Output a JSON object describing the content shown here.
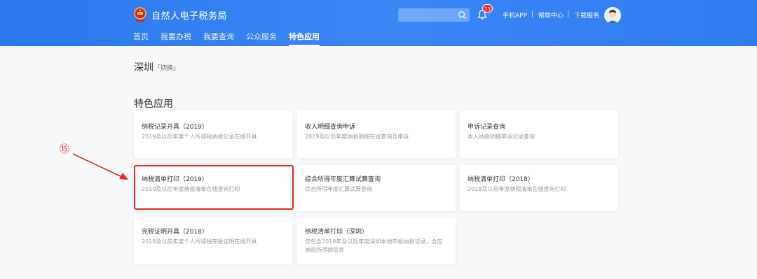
{
  "header": {
    "site_title": "自然人电子税务局",
    "nav": [
      "首页",
      "我要办税",
      "我要查询",
      "公众服务",
      "特色应用"
    ],
    "active_nav": "特色应用",
    "search_placeholder": "",
    "notification_count": "13",
    "links": [
      "手机APP",
      "帮助中心",
      "下载服务"
    ]
  },
  "location": {
    "city": "深圳",
    "switch_label": "「切换」"
  },
  "section": {
    "title": "特色应用"
  },
  "cards": [
    {
      "title": "纳税记录开具（2019）",
      "desc": [
        "2019及以后年度个人所得税纳税记录在线开具"
      ]
    },
    {
      "title": "收入明细查询申诉",
      "desc": [
        "2019及以后年度纳税明细在线查询及申诉"
      ]
    },
    {
      "title": "申诉记录查询",
      "desc": [
        "收入纳税明细申诉记录查询"
      ]
    },
    {
      "title": "纳税清单打印（2019）",
      "desc": [
        "2019及以后年度纳税清单在线查询打印"
      ]
    },
    {
      "title": "综合所得年度汇算试算查询",
      "desc": [
        "综合所得年度汇算试算查询"
      ]
    },
    {
      "title": "纳税清单打印（2018）",
      "desc": [
        "2018及以前年度纳税清单在线查询打印"
      ]
    },
    {
      "title": "完税证明开具（2018）",
      "desc": [
        "2018及以前年度个人所得税完税证明在线开具"
      ]
    },
    {
      "title": "纳税清单打印（深圳）",
      "desc": [
        "仅包含2019年及以后年度深圳本地申报纳税记录，含应",
        "纳税所得额信息"
      ]
    }
  ],
  "annotation": {
    "step_marker": "⑮",
    "highlight_color": "#e8271f"
  },
  "colors": {
    "header_blue": "#2f7cf0",
    "badge_red": "#f5222d"
  },
  "icons": [
    "national-emblem-icon",
    "search-icon",
    "bell-icon",
    "avatar"
  ]
}
